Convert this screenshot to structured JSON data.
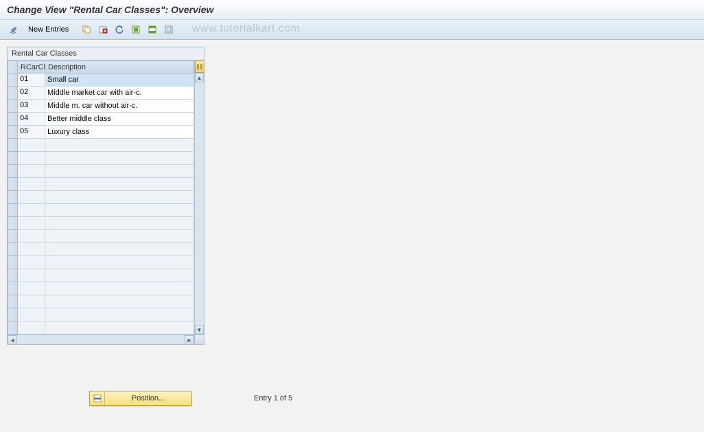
{
  "title": "Change View \"Rental Car Classes\": Overview",
  "toolbar": {
    "new_entries_label": "New Entries"
  },
  "watermark": "www.tutorialkart.com",
  "panel": {
    "title": "Rental Car Classes",
    "columns": {
      "code": "RCarCl",
      "desc": "Description"
    },
    "rows": [
      {
        "code": "01",
        "desc": "Small car",
        "selected": true
      },
      {
        "code": "02",
        "desc": "Middle market car with air-c."
      },
      {
        "code": "03",
        "desc": "Middle m. car without air-c."
      },
      {
        "code": "04",
        "desc": "Better middle class"
      },
      {
        "code": "05",
        "desc": "Luxury class"
      }
    ],
    "empty_rows": 15
  },
  "footer": {
    "position_label": "Position...",
    "entry_text": "Entry 1 of 5"
  }
}
